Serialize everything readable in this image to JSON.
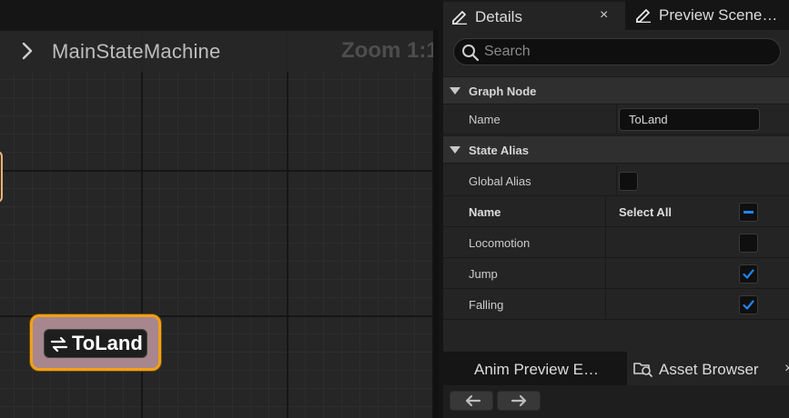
{
  "graph": {
    "breadcrumb": "MainStateMachine",
    "zoom": "Zoom 1:1",
    "node": {
      "label": "ToLand",
      "icon": "transition-arrows-icon"
    }
  },
  "details": {
    "tabs": [
      {
        "label": "Details",
        "icon": "pencil-icon",
        "active": true
      },
      {
        "label": "Preview Scene…",
        "icon": "pencil-icon",
        "active": false
      }
    ],
    "close_glyph": "×",
    "search": {
      "placeholder": "Search"
    },
    "categories": [
      {
        "label": "Graph Node"
      },
      {
        "label": "State Alias"
      }
    ],
    "graph_node": {
      "name_label": "Name",
      "name_value": "ToLand"
    },
    "state_alias": {
      "global_alias_label": "Global Alias",
      "global_alias_checked": false,
      "header_name": "Name",
      "header_select_all": "Select All",
      "select_all_state": "indeterminate",
      "states": [
        {
          "label": "Locomotion",
          "checked": false
        },
        {
          "label": "Jump",
          "checked": true
        },
        {
          "label": "Falling",
          "checked": true
        }
      ]
    }
  },
  "lower": {
    "tabs": [
      {
        "label": "Anim Preview E…"
      },
      {
        "label": "Asset Browser",
        "icon": "folder-search-icon"
      }
    ],
    "close_glyph": "×"
  },
  "colors": {
    "accent": "#1f86f0",
    "node_border": "#f1a018",
    "node_fill": "#a7868d",
    "panel_bg": "#242424"
  }
}
